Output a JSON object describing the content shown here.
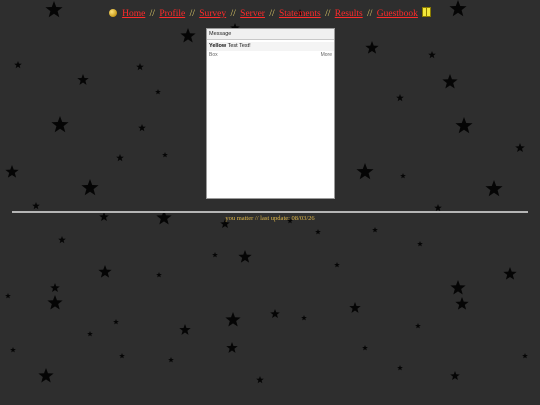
{
  "nav": {
    "items": [
      "Home",
      "Profile",
      "Survey",
      "Server",
      "Statements",
      "Results",
      "Guestbook"
    ],
    "separator": "//"
  },
  "message_box": {
    "header": "Message",
    "entry_name": "Yellow",
    "entry_text": "Test Test!",
    "footer_left": "Box",
    "footer_right": "More"
  },
  "footer": {
    "text": "you matter // last update: 08/03/26"
  },
  "colors": {
    "background": "#2e2e2e",
    "link": "#ff2a2a",
    "accent_text": "#e0b84a",
    "star": "#050505"
  },
  "icons": [
    "smiley-icon",
    "book-icon",
    "star-icon"
  ]
}
